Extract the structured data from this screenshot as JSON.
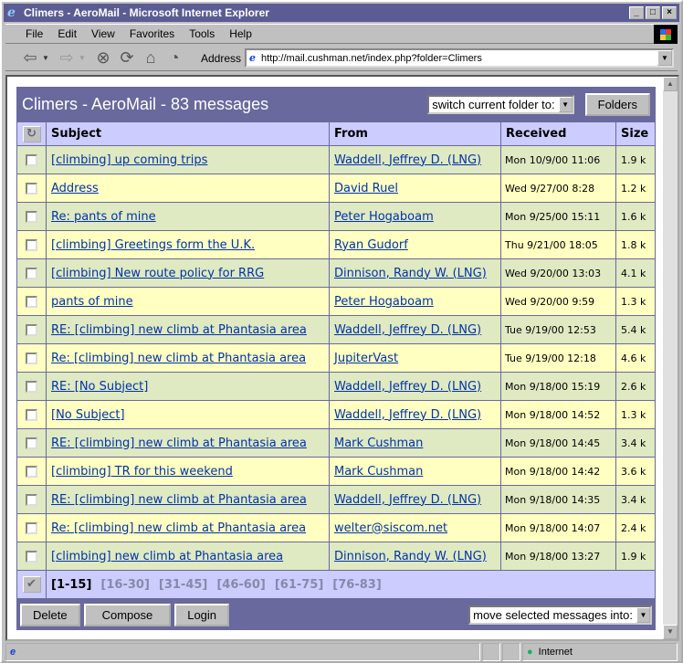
{
  "window": {
    "title": "Climers - AeroMail - Microsoft Internet Explorer"
  },
  "menu": [
    "File",
    "Edit",
    "View",
    "Favorites",
    "Tools",
    "Help"
  ],
  "address": {
    "label": "Address",
    "url": "http://mail.cushman.net/index.php?folder=Climers"
  },
  "header": {
    "title": "Climers - AeroMail - 83 messages",
    "folder_select": "switch current folder to:",
    "folders_button": "Folders"
  },
  "columns": {
    "subject": "Subject",
    "from": "From",
    "received": "Received",
    "size": "Size"
  },
  "messages": [
    {
      "subject": "[climbing] up coming trips",
      "from": "Waddell, Jeffrey D. (LNG)",
      "received": "Mon 10/9/00 11:06",
      "size": "1.9 k"
    },
    {
      "subject": "Address",
      "from": "David Ruel",
      "received": "Wed 9/27/00 8:28",
      "size": "1.2 k"
    },
    {
      "subject": "Re: pants of mine",
      "from": "Peter Hogaboam",
      "received": "Mon 9/25/00 15:11",
      "size": "1.6 k"
    },
    {
      "subject": "[climbing] Greetings form the U.K.",
      "from": "Ryan Gudorf",
      "received": "Thu 9/21/00 18:05",
      "size": "1.8 k"
    },
    {
      "subject": "[climbing] New route policy for RRG",
      "from": "Dinnison, Randy W. (LNG)",
      "received": "Wed 9/20/00 13:03",
      "size": "4.1 k"
    },
    {
      "subject": "pants of mine",
      "from": "Peter Hogaboam",
      "received": "Wed 9/20/00 9:59",
      "size": "1.3 k"
    },
    {
      "subject": "RE: [climbing] new climb at Phantasia area",
      "from": "Waddell, Jeffrey D. (LNG)",
      "received": "Tue 9/19/00 12:53",
      "size": "5.4 k"
    },
    {
      "subject": "Re: [climbing] new climb at Phantasia area",
      "from": "JupiterVast",
      "received": "Tue 9/19/00 12:18",
      "size": "4.6 k"
    },
    {
      "subject": "RE: [No Subject]",
      "from": "Waddell, Jeffrey D. (LNG)",
      "received": "Mon 9/18/00 15:19",
      "size": "2.6 k"
    },
    {
      "subject": "[No Subject]",
      "from": "Waddell, Jeffrey D. (LNG)",
      "received": "Mon 9/18/00 14:52",
      "size": "1.3 k"
    },
    {
      "subject": "RE: [climbing] new climb at Phantasia area",
      "from": "Mark Cushman",
      "received": "Mon 9/18/00 14:45",
      "size": "3.4 k"
    },
    {
      "subject": "[climbing] TR for this weekend",
      "from": "Mark Cushman",
      "received": "Mon 9/18/00 14:42",
      "size": "3.6 k"
    },
    {
      "subject": "RE: [climbing] new climb at Phantasia area",
      "from": "Waddell, Jeffrey D. (LNG)",
      "received": "Mon 9/18/00 14:35",
      "size": "3.4 k"
    },
    {
      "subject": "Re: [climbing] new climb at Phantasia area",
      "from": "welter@siscom.net",
      "received": "Mon 9/18/00 14:07",
      "size": "2.4 k"
    },
    {
      "subject": "[climbing] new climb at Phantasia area",
      "from": "Dinnison, Randy W. (LNG)",
      "received": "Mon 9/18/00 13:27",
      "size": "1.9 k"
    }
  ],
  "pages": [
    "[1-15]",
    "[16-30]",
    "[31-45]",
    "[46-60]",
    "[61-75]",
    "[76-83]"
  ],
  "footer": {
    "delete": "Delete",
    "compose": "Compose",
    "login": "Login",
    "move_select": "move selected messages into:"
  },
  "status": {
    "zone": "Internet"
  }
}
